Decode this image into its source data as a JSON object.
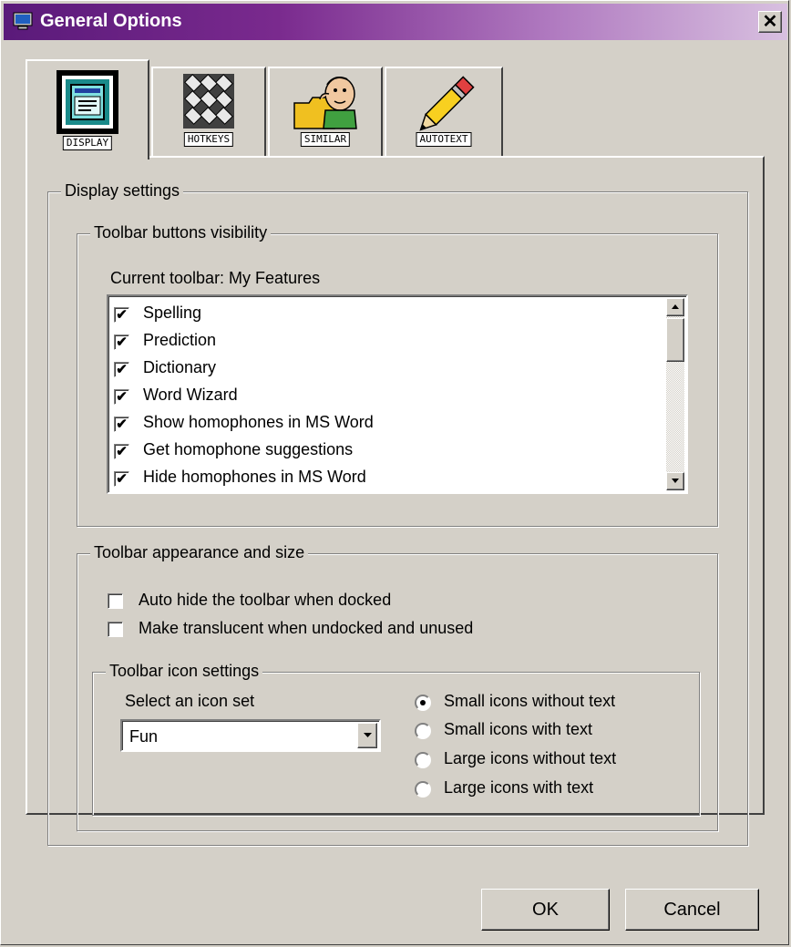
{
  "window": {
    "title": "General Options",
    "close_symbol": "✕"
  },
  "tabs": [
    {
      "label": "DISPLAY",
      "icon": "display-icon",
      "active": true
    },
    {
      "label": "HOTKEYS",
      "icon": "hotkeys-icon",
      "active": false
    },
    {
      "label": "SIMILAR",
      "icon": "similar-icon",
      "active": false
    },
    {
      "label": "AUTOTEXT",
      "icon": "autotext-icon",
      "active": false
    }
  ],
  "display_settings": {
    "label": "Display settings",
    "visibility": {
      "label": "Toolbar buttons visibility",
      "current_toolbar_label": "Current toolbar: My Features",
      "items": [
        {
          "label": "Spelling",
          "checked": true
        },
        {
          "label": "Prediction",
          "checked": true
        },
        {
          "label": "Dictionary",
          "checked": true
        },
        {
          "label": "Word Wizard",
          "checked": true
        },
        {
          "label": "Show homophones in MS Word",
          "checked": true
        },
        {
          "label": "Get homophone suggestions",
          "checked": true
        },
        {
          "label": "Hide homophones in MS Word",
          "checked": true
        }
      ]
    },
    "appearance": {
      "label": "Toolbar appearance and size",
      "auto_hide": {
        "label": "Auto hide the toolbar when docked",
        "checked": false
      },
      "translucent": {
        "label": "Make translucent when undocked and unused",
        "checked": false
      },
      "icon_settings": {
        "label": "Toolbar icon settings",
        "select_label": "Select an icon set",
        "selected_set": "Fun",
        "options": [
          {
            "label": "Small icons without text",
            "selected": true
          },
          {
            "label": "Small icons with text",
            "selected": false
          },
          {
            "label": "Large icons without text",
            "selected": false
          },
          {
            "label": "Large icons with text",
            "selected": false
          }
        ]
      }
    }
  },
  "buttons": {
    "ok": "OK",
    "cancel": "Cancel"
  },
  "check_mark": "✔"
}
